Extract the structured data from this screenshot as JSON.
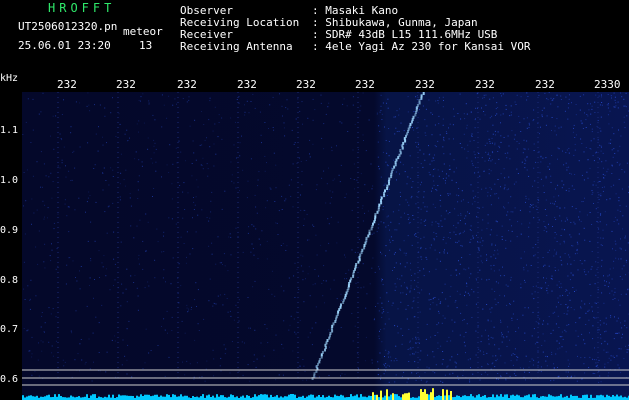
{
  "header": {
    "brand": "HROFFT",
    "filename": "UT2506012320.pn",
    "type_label": "meteor",
    "datetime": "25.06.01 23:20",
    "count": "13",
    "fields": [
      {
        "label": "Observer",
        "value": ": Masaki Kano"
      },
      {
        "label": "Receiving Location",
        "value": ": Shibukawa, Gunma, Japan"
      },
      {
        "label": "Receiver",
        "value": ": SDR# 43dB L15 111.6MHz USB"
      },
      {
        "label": "Receiving Antenna",
        "value": ": 4ele Yagi Az 230 for Kansai VOR"
      }
    ]
  },
  "spectrogram": {
    "y_unit": "kHz",
    "x_ticks": [
      "232",
      "232",
      "232",
      "232",
      "232",
      "232",
      "232",
      "232",
      "232",
      "2330"
    ],
    "y_ticks": [
      "1.1",
      "1.0",
      "0.9",
      "0.8",
      "0.7",
      "0.6"
    ],
    "colors": {
      "background": "#04082a",
      "noise": "#2a4fd8",
      "trace": "#9fd8ff",
      "reference_line": "#cfcfcf",
      "level_low": "#00c8ff",
      "level_high": "#ffff33"
    }
  }
}
